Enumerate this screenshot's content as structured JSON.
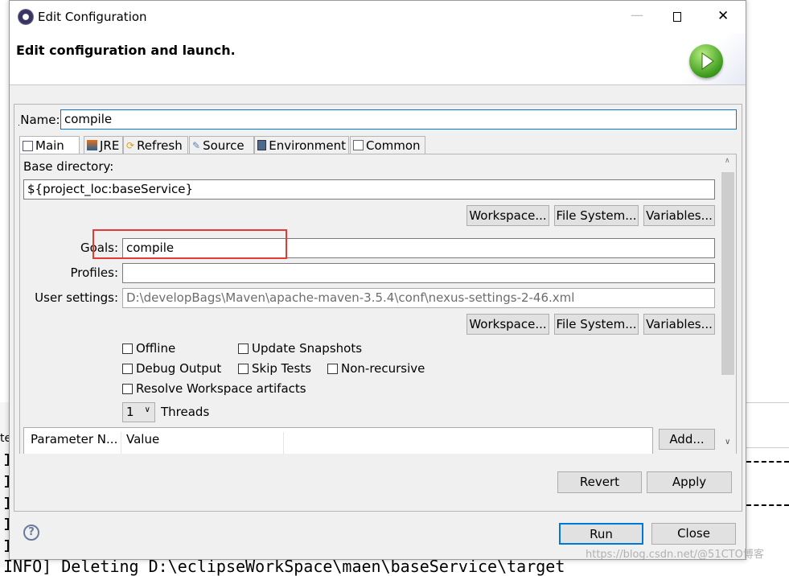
{
  "background": {
    "console_lines": [
      "I",
      "I",
      "I",
      "I",
      "I"
    ],
    "console_last_line": "INFO] Deleting D:\\eclipseWorkSpace\\maen\\baseService\\target",
    "left_strip_text": "te",
    "watermark": "https://blog.csdn.net/@51CTO博客"
  },
  "dialog": {
    "title": "Edit Configuration",
    "header": "Edit configuration and launch.",
    "name_label": "Name:",
    "name_value": "compile",
    "tabs": [
      {
        "label": "Main",
        "icon": "main-tab-icon"
      },
      {
        "label": "JRE",
        "icon": "jre-icon"
      },
      {
        "label": "Refresh",
        "icon": "refresh-icon"
      },
      {
        "label": "Source",
        "icon": "source-icon"
      },
      {
        "label": "Environment",
        "icon": "environment-icon"
      },
      {
        "label": "Common",
        "icon": "common-icon"
      }
    ],
    "main": {
      "base_dir_label": "Base directory:",
      "base_dir_value": "${project_loc:baseService}",
      "workspace_btn": "Workspace...",
      "filesystem_btn": "File System...",
      "variables_btn": "Variables...",
      "goals_label": "Goals:",
      "goals_value": "compile",
      "profiles_label": "Profiles:",
      "profiles_value": "",
      "user_settings_label": "User settings:",
      "user_settings_value": "D:\\developBags\\Maven\\apache-maven-3.5.4\\conf\\nexus-settings-2-46.xml",
      "checkboxes": {
        "offline": "Offline",
        "update_snapshots": "Update Snapshots",
        "debug_output": "Debug Output",
        "skip_tests": "Skip Tests",
        "non_recursive": "Non-recursive",
        "resolve_workspace": "Resolve Workspace artifacts"
      },
      "threads_value": "1",
      "threads_label": "Threads",
      "table_headers": [
        "Parameter N...",
        "Value"
      ],
      "add_btn": "Add..."
    },
    "revert_btn": "Revert",
    "apply_btn": "Apply",
    "run_btn": "Run",
    "close_btn": "Close",
    "highlight_color": "#e53935"
  }
}
